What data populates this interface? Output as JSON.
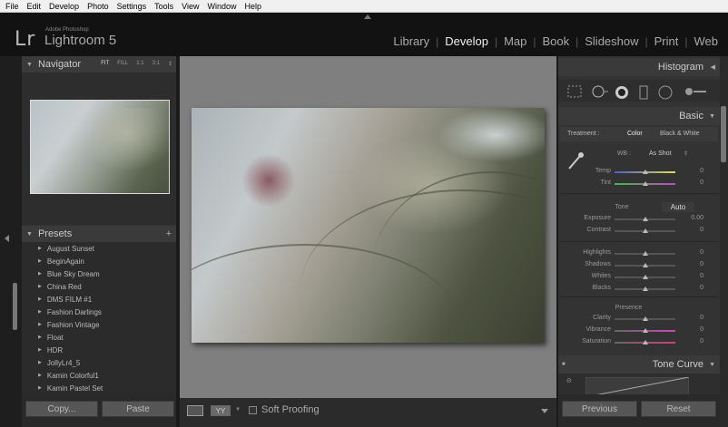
{
  "menu": [
    "File",
    "Edit",
    "Develop",
    "Photo",
    "Settings",
    "Tools",
    "View",
    "Window",
    "Help"
  ],
  "brand": {
    "logo": "Lr",
    "vendor": "Adobe Photoshop",
    "product": "Lightroom 5"
  },
  "modules": [
    {
      "label": "Library",
      "active": false
    },
    {
      "label": "Develop",
      "active": true
    },
    {
      "label": "Map",
      "active": false
    },
    {
      "label": "Book",
      "active": false
    },
    {
      "label": "Slideshow",
      "active": false
    },
    {
      "label": "Print",
      "active": false
    },
    {
      "label": "Web",
      "active": false
    }
  ],
  "navigator": {
    "title": "Navigator",
    "zoom_options": [
      "FIT",
      "FILL",
      "1:1",
      "3:1"
    ],
    "selected_zoom": "FIT"
  },
  "presets": {
    "title": "Presets",
    "add_symbol": "+",
    "items": [
      "August Sunset",
      "BeginAgain",
      "Blue Sky Dream",
      "China Red",
      "DMS FILM #1",
      "Fashion Darlings",
      "Fashion Vintage",
      "Float",
      "HDR",
      "JollyLr4_5",
      "Kamin Colorful1",
      "Kamin Pastel Set"
    ]
  },
  "left_buttons": {
    "copy": "Copy...",
    "paste": "Paste"
  },
  "toolbar": {
    "yy_label": "YY",
    "soft_proofing": "Soft Proofing"
  },
  "histogram": {
    "title": "Histogram"
  },
  "basic": {
    "title": "Basic",
    "treatment_label": "Treatment :",
    "treatment_color": "Color",
    "treatment_bw": "Black & White",
    "wb_label": "WB :",
    "wb_value": "As Shot",
    "wb_sliders": [
      {
        "label": "Temp",
        "value": "0",
        "level": 0.5,
        "track": "temp"
      },
      {
        "label": "Tint",
        "value": "0",
        "level": 0.5,
        "track": "tint"
      }
    ],
    "tone_label": "Tone",
    "auto_label": "Auto",
    "tone_sliders": [
      {
        "label": "Exposure",
        "value": "0.00",
        "level": 0.5
      },
      {
        "label": "Contrast",
        "value": "0",
        "level": 0.5
      }
    ],
    "tone2_sliders": [
      {
        "label": "Highlights",
        "value": "0",
        "level": 0.5
      },
      {
        "label": "Shadows",
        "value": "0",
        "level": 0.5
      },
      {
        "label": "Whites",
        "value": "0",
        "level": 0.5
      },
      {
        "label": "Blacks",
        "value": "0",
        "level": 0.5
      }
    ],
    "presence_label": "Presence",
    "presence_sliders": [
      {
        "label": "Clarity",
        "value": "0",
        "level": 0.5,
        "track": "plain"
      },
      {
        "label": "Vibrance",
        "value": "0",
        "level": 0.5,
        "track": "vibrance"
      },
      {
        "label": "Saturation",
        "value": "0",
        "level": 0.5,
        "track": "saturation"
      }
    ]
  },
  "tone_curve": {
    "title": "Tone Curve"
  },
  "right_buttons": {
    "previous": "Previous",
    "reset": "Reset"
  },
  "colors": {
    "accent_temp_left": "#4a5fd0",
    "accent_temp_right": "#e6d94a",
    "accent_tint_left": "#3fb84a",
    "accent_tint_right": "#c44ab8",
    "vibrance_right": "#c44ab8",
    "saturation_right": "#d23f7a"
  }
}
